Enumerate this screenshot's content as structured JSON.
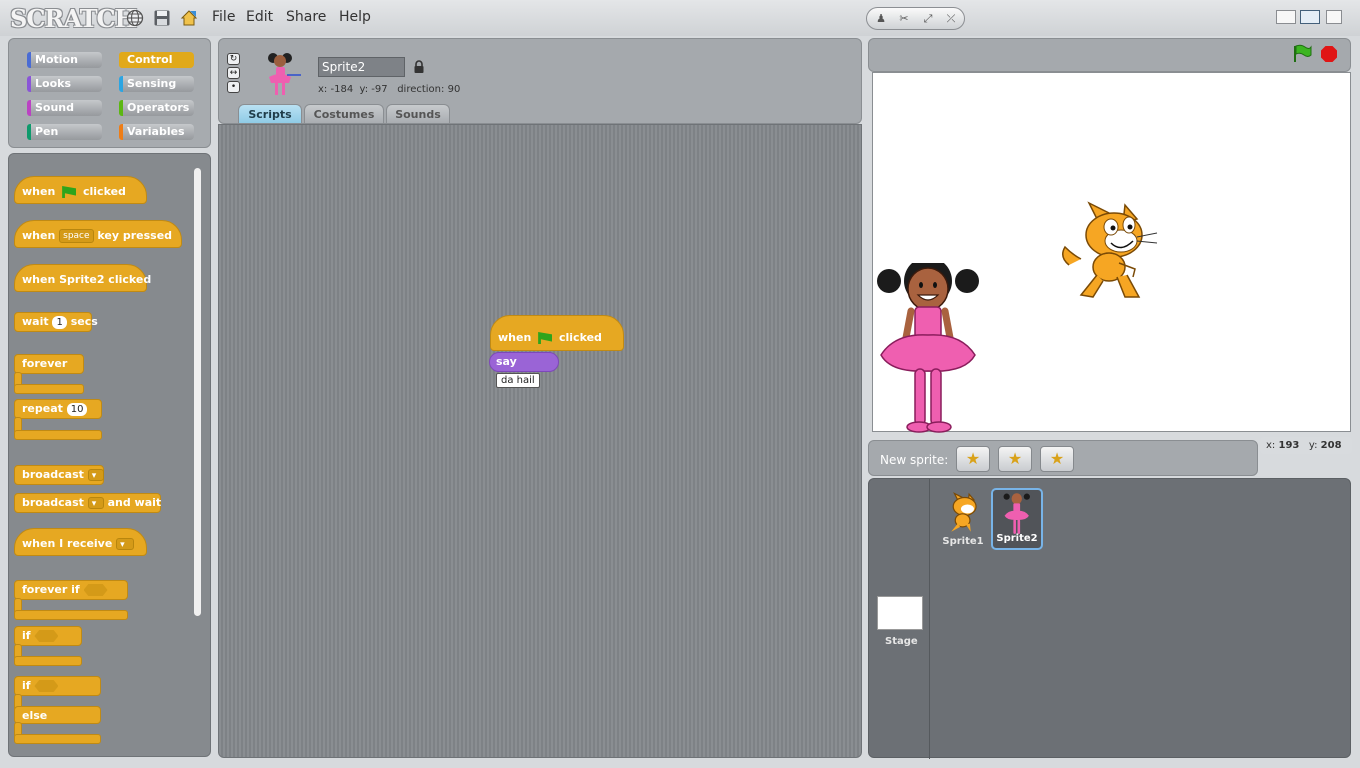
{
  "app": {
    "logo": "SCRATCH"
  },
  "menu": {
    "file": "File",
    "edit": "Edit",
    "share": "Share",
    "help": "Help"
  },
  "icons": {
    "globe": "globe-icon",
    "save": "save-icon",
    "share": "share-icon",
    "stamp": "stamp-icon",
    "scissors": "scissors-icon",
    "grow": "grow-icon",
    "shrink": "shrink-icon",
    "green_flag": "green-flag-icon",
    "stop": "stop-icon",
    "lock": "lock-icon"
  },
  "categories": {
    "motion": "Motion",
    "looks": "Looks",
    "sound": "Sound",
    "pen": "Pen",
    "control": "Control",
    "sensing": "Sensing",
    "operators": "Operators",
    "variables": "Variables"
  },
  "colors": {
    "motion": "#4a6cd4",
    "looks": "#8a55d7",
    "sound": "#bb42c3",
    "pen": "#0e9a6c",
    "control": "#e1a91a",
    "sensing": "#2ca5e2",
    "operators": "#5cb712",
    "variables": "#ee7d16"
  },
  "palette": {
    "when_flag_1": "when",
    "when_flag_2": "clicked",
    "when_key_1": "when",
    "when_key_dropdown": "space",
    "when_key_2": "key pressed",
    "when_sprite_clicked": "when Sprite2 clicked",
    "wait_1": "wait",
    "wait_value": "1",
    "wait_2": "secs",
    "forever": "forever",
    "repeat": "repeat",
    "repeat_value": "10",
    "broadcast": "broadcast",
    "broadcast_wait_1": "broadcast",
    "broadcast_wait_2": "and wait",
    "when_receive": "when I receive",
    "forever_if": "forever if",
    "if_1": "if",
    "if_2": "if",
    "else": "else"
  },
  "sprite_info": {
    "name": "Sprite2",
    "x_label": "x:",
    "x_value": "-184",
    "y_label": "y:",
    "y_value": "-97",
    "direction_label": "direction:",
    "direction_value": "90"
  },
  "tabs": {
    "scripts": "Scripts",
    "costumes": "Costumes",
    "sounds": "Sounds"
  },
  "script": {
    "hat_1": "when",
    "hat_2": "clicked",
    "say": "say",
    "say_value": "da hail"
  },
  "stage_coords": {
    "x_label": "x:",
    "x_value": "193",
    "y_label": "y:",
    "y_value": "208"
  },
  "new_sprite": {
    "label": "New sprite:"
  },
  "sprites": [
    {
      "name": "Sprite1"
    },
    {
      "name": "Sprite2"
    }
  ],
  "stage_thumb": {
    "label": "Stage"
  }
}
